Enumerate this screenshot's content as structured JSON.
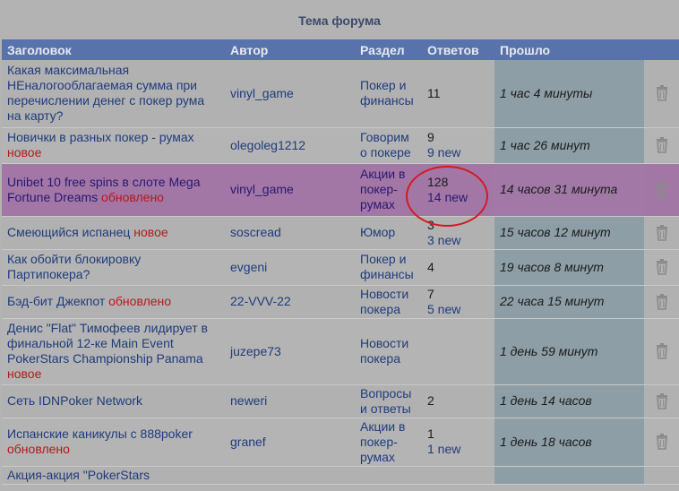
{
  "forum": {
    "title": "Тема форума",
    "columns": {
      "title": "Заголовок",
      "author": "Автор",
      "section": "Раздел",
      "replies": "Ответов",
      "elapsed": "Прошло"
    },
    "rows": [
      {
        "title": "Какая максимальная НЕналогооблагаемая сумма при перечислении денег с покер рума на карту?",
        "flag": "",
        "author": "vinyl_game",
        "section": "Покер и финансы",
        "replies": "11",
        "new": "",
        "elapsed": "1 час 4 минуты"
      },
      {
        "title": "Новички в разных покер - румах",
        "flag": "новое",
        "author": "olegoleg1212",
        "section": "Говорим о покере",
        "replies": "9",
        "new": "9 new",
        "elapsed": "1 час 26 минут"
      },
      {
        "title": "Unibet 10 free spins в слоте Mega Fortune Dreams",
        "flag": "обновлено",
        "author": "vinyl_game",
        "section": "Акции в покер-румах",
        "replies": "128",
        "new": "14 new",
        "elapsed": "14 часов 31 минута"
      },
      {
        "title": "Смеющийся испанец",
        "flag": "новое",
        "author": "soscread",
        "section": "Юмор",
        "replies": "3",
        "new": "3 new",
        "elapsed": "15 часов 12 минут"
      },
      {
        "title": "Как обойти блокировку Партипокера?",
        "flag": "",
        "author": "evgeni",
        "section": "Покер и финансы",
        "replies": "4",
        "new": "",
        "elapsed": "19 часов 8 минут"
      },
      {
        "title": "Бэд-бит Джекпот",
        "flag": "обновлено",
        "author": "22-VVV-22",
        "section": "Новости покера",
        "replies": "7",
        "new": "5 new",
        "elapsed": "22 часа 15 минут"
      },
      {
        "title": "Денис \"Flat\" Тимофеев лидирует в финальной 12-ке Main Event PokerStars Championship Panama",
        "flag": "новое",
        "author": "juzepe73",
        "section": "Новости покера",
        "replies": "",
        "new": "",
        "elapsed": "1 день 59 минут"
      },
      {
        "title": "Сеть IDNPoker Network",
        "flag": "",
        "author": "neweri",
        "section": "Вопросы и ответы",
        "replies": "2",
        "new": "",
        "elapsed": "1 день 14 часов"
      },
      {
        "title": "Испанские каникулы с 888poker",
        "flag": "обновлено",
        "author": "granef",
        "section": "Акции в покер-румах",
        "replies": "1",
        "new": "1 new",
        "elapsed": "1 день 18 часов"
      },
      {
        "title": "Акция-акция \"PokerStars",
        "flag": "",
        "author": "",
        "section": "",
        "replies": "",
        "new": "",
        "elapsed": ""
      }
    ]
  },
  "icons": {
    "delete": "trash-icon"
  },
  "colors": {
    "header": "#5873ac",
    "highlight": "#a277a6",
    "flag": "#b5191a",
    "annotation": "#d41920"
  }
}
